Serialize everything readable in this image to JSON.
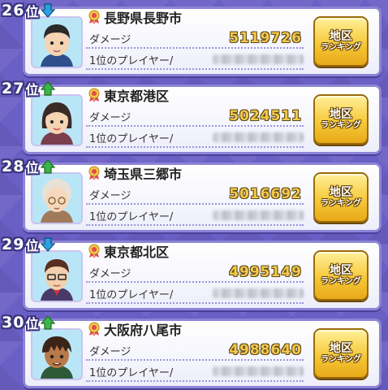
{
  "colors": {
    "accent": "#6a5fc4",
    "damage": "#f5c84b",
    "button": "#f6c93a",
    "up": "#3bb54a",
    "down": "#2ba0e0"
  },
  "rows": [
    {
      "rank": "26",
      "suffix": "位",
      "trend": "down",
      "region": "長野県長野市",
      "damage_label": "ダメージ",
      "damage": "5119726",
      "player_label": "1位のプレイヤー/",
      "button_line1": "地区",
      "button_line2": "ランキング",
      "avatar": "man-black-hair"
    },
    {
      "rank": "27",
      "suffix": "位",
      "trend": "up",
      "region": "東京都港区",
      "damage_label": "ダメージ",
      "damage": "5024511",
      "player_label": "1位のプレイヤー/",
      "button_line1": "地区",
      "button_line2": "ランキング",
      "avatar": "woman-dark-hair"
    },
    {
      "rank": "28",
      "suffix": "位",
      "trend": "up",
      "region": "埼玉県三郷市",
      "damage_label": "ダメージ",
      "damage": "5016692",
      "player_label": "1位のプレイヤー/",
      "button_line1": "地区",
      "button_line2": "ランキング",
      "avatar": "grandma-glasses"
    },
    {
      "rank": "29",
      "suffix": "位",
      "trend": "down",
      "region": "東京都北区",
      "damage_label": "ダメージ",
      "damage": "4995149",
      "player_label": "1位のプレイヤー/",
      "button_line1": "地区",
      "button_line2": "ランキング",
      "avatar": "man-glasses"
    },
    {
      "rank": "30",
      "suffix": "位",
      "trend": "up",
      "region": "大阪府八尾市",
      "damage_label": "ダメージ",
      "damage": "4988640",
      "player_label": "1位のプレイヤー/",
      "button_line1": "地区",
      "button_line2": "ランキング",
      "avatar": "boy-tan"
    }
  ]
}
